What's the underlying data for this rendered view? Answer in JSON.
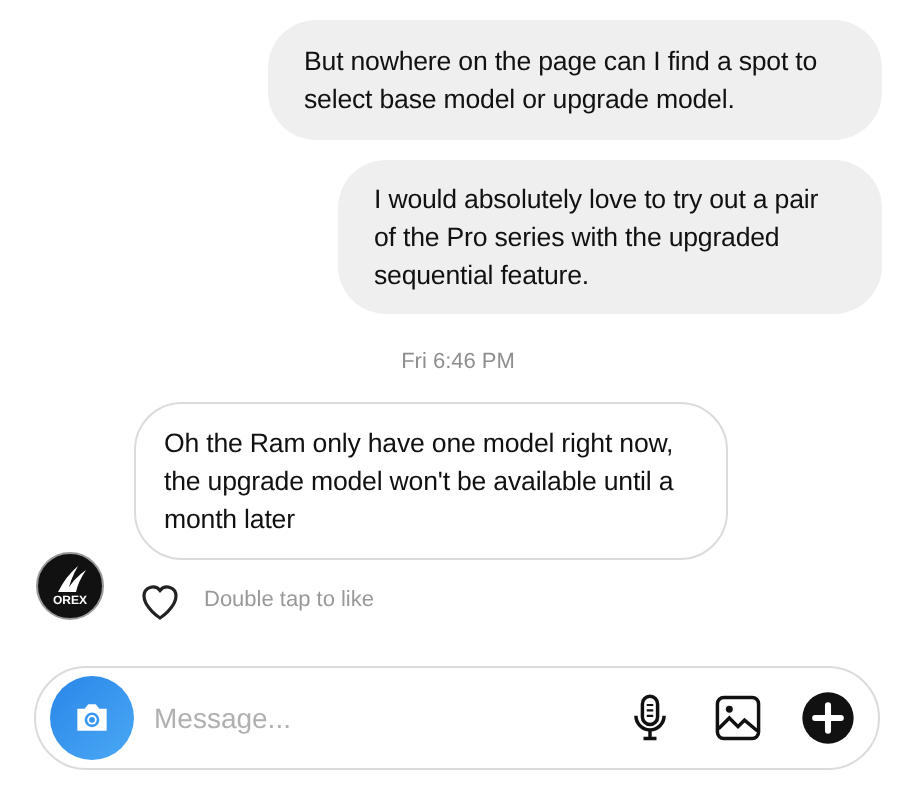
{
  "messages": [
    {
      "kind": "sent",
      "text": "But nowhere on the page can I find a spot to select base model or upgrade model."
    },
    {
      "kind": "sent",
      "text": "I would absolutely love to try out a pair of the Pro series with the upgraded sequential feature."
    },
    {
      "kind": "timestamp",
      "text": "Fri 6:46 PM"
    },
    {
      "kind": "received",
      "text": "Oh the Ram only have one model right now, the upgrade model won't be available until a month later",
      "avatar_text": "OREX",
      "liked": false,
      "like_hint": "Double tap to like"
    }
  ],
  "composer": {
    "placeholder": "Message..."
  }
}
